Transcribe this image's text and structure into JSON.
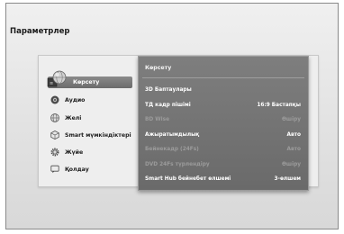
{
  "settings": {
    "title": "Параметрлер"
  },
  "menu": {
    "items": [
      {
        "label": "Көрсету",
        "icon": "picture-globe-icon",
        "active": true
      },
      {
        "label": "Аудио",
        "icon": "audio-speaker-icon",
        "active": false
      },
      {
        "label": "Желі",
        "icon": "network-globe-icon",
        "active": false
      },
      {
        "label": "Smart мүмкіндіктері",
        "icon": "smart-cube-icon",
        "active": false
      },
      {
        "label": "Жүйе",
        "icon": "system-gear-icon",
        "active": false
      },
      {
        "label": "Қолдау",
        "icon": "support-chat-icon",
        "active": false
      }
    ]
  },
  "detail": {
    "title": "Көрсету",
    "rows": [
      {
        "label": "3D Баптаулары",
        "value": "",
        "disabled": false
      },
      {
        "label": "ТД кадр пішімі",
        "value": "16:9 Бастапқы",
        "disabled": false
      },
      {
        "label": "BD Wise",
        "value": "Өшіру",
        "disabled": true
      },
      {
        "label": "Ажыратымдылық",
        "value": "Авто",
        "disabled": false
      },
      {
        "label": "Бейнекадр (24Fs)",
        "value": "Авто",
        "disabled": true
      },
      {
        "label": "DVD 24Fs түрлендіру",
        "value": "Өшіру",
        "disabled": true
      },
      {
        "label": "Smart Hub бейнебет өлшемі",
        "value": "3-өлшем",
        "disabled": false
      }
    ]
  },
  "colors": {
    "highlight": "#7a7a7a",
    "panel": "#747474",
    "text_disabled": "#9b9b9b"
  }
}
